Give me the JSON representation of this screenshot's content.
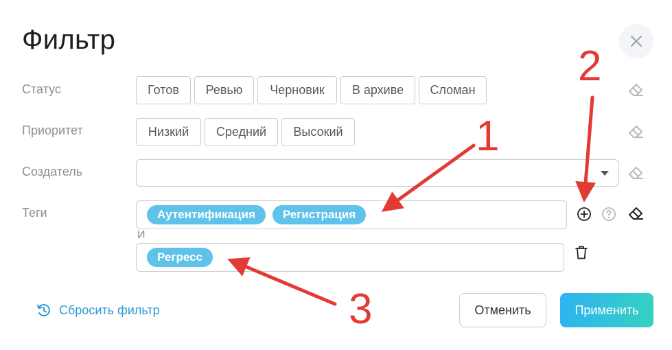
{
  "dialog": {
    "title": "Фильтр"
  },
  "rows": {
    "status": {
      "label": "Статус",
      "options": [
        "Готов",
        "Ревью",
        "Черновик",
        "В архиве",
        "Сломан"
      ]
    },
    "priority": {
      "label": "Приоритет",
      "options": [
        "Низкий",
        "Средний",
        "Высокий"
      ]
    },
    "creator": {
      "label": "Создатель",
      "value": ""
    },
    "tags": {
      "label": "Теги",
      "group1": [
        "Аутентификация",
        "Регистрация"
      ],
      "conjunction": "И",
      "group2": [
        "Регресс"
      ]
    }
  },
  "footer": {
    "reset_label": "Сбросить фильтр",
    "cancel_label": "Отменить",
    "apply_label": "Применить"
  },
  "annotations": [
    "1",
    "2",
    "3"
  ],
  "colors": {
    "tag_bg": "#5ec2ea",
    "link": "#2d9bd6",
    "annotation": "#e23a34",
    "apply_gradient_start": "#2fb3f0",
    "apply_gradient_end": "#35d1c2"
  }
}
